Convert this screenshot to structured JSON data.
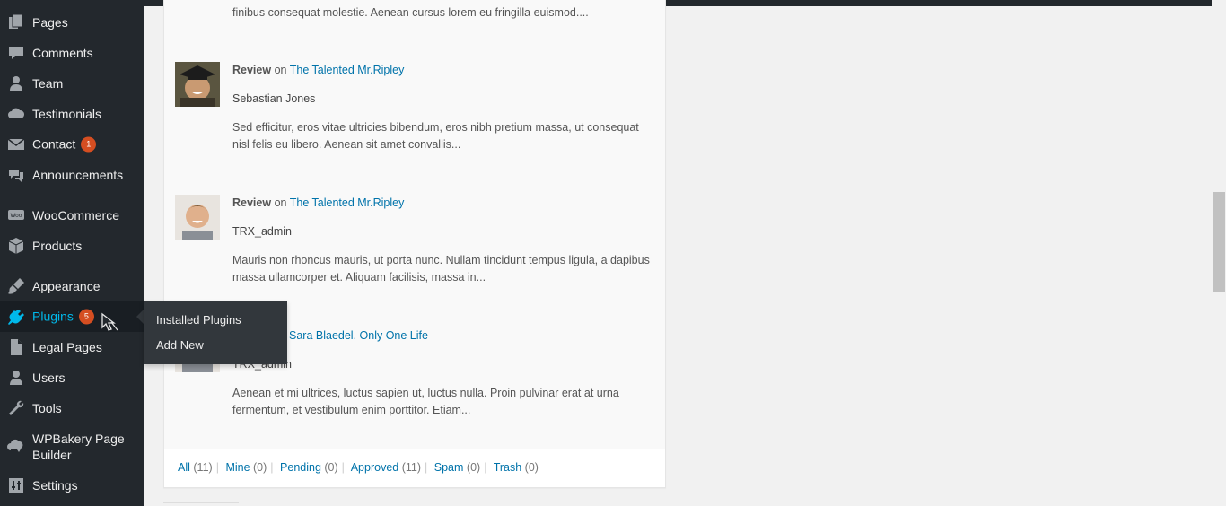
{
  "sidebar": {
    "items": [
      {
        "label": "Pages",
        "icon": "pages-icon"
      },
      {
        "label": "Comments",
        "icon": "comments-icon"
      },
      {
        "label": "Team",
        "icon": "team-icon"
      },
      {
        "label": "Testimonials",
        "icon": "testimonials-icon"
      },
      {
        "label": "Contact",
        "icon": "mail-icon",
        "badge": "1"
      },
      {
        "label": "Announcements",
        "icon": "announcements-icon"
      },
      {
        "label": "WooCommerce",
        "icon": "woocommerce-icon"
      },
      {
        "label": "Products",
        "icon": "products-icon"
      },
      {
        "label": "Appearance",
        "icon": "appearance-icon"
      },
      {
        "label": "Plugins",
        "icon": "plugins-icon",
        "badge": "5",
        "active": true
      },
      {
        "label": "Legal Pages",
        "icon": "legal-pages-icon"
      },
      {
        "label": "Users",
        "icon": "users-icon"
      },
      {
        "label": "Tools",
        "icon": "tools-icon"
      },
      {
        "label": "WPBakery Page Builder",
        "icon": "wpbakery-icon"
      },
      {
        "label": "Settings",
        "icon": "settings-icon"
      }
    ],
    "flyout": {
      "items": [
        "Installed Plugins",
        "Add New"
      ]
    }
  },
  "comments": {
    "top_snippet": "finibus consequat molestie. Aenean cursus lorem eu fringilla euismod....",
    "items": [
      {
        "type": "Review",
        "on": "on",
        "post": "The Talented Mr.Ripley",
        "author": "Sebastian Jones",
        "text": "Sed efficitur, eros vitae ultricies bibendum, eros nibh pretium massa, ut consequat nisl felis eu libero. Aenean sit amet convallis..."
      },
      {
        "type": "Review",
        "on": "on",
        "post": "The Talented Mr.Ripley",
        "author": "TRX_admin",
        "text": "Mauris non rhoncus mauris, ut porta nunc. Nullam tincidunt tempus ligula, a dapibus massa ullamcorper et. Aliquam facilisis, massa in..."
      },
      {
        "post": "Sara Blaedel. Only One Life",
        "author": "TRX_admin",
        "text": "Aenean et mi ultrices, luctus sapien ut, luctus nulla. Proin pulvinar erat at urna fermentum, et vestibulum enim porttitor. Etiam..."
      }
    ]
  },
  "filters": [
    {
      "label": "All",
      "count": "(11)"
    },
    {
      "label": "Mine",
      "count": "(0)"
    },
    {
      "label": "Pending",
      "count": "(0)"
    },
    {
      "label": "Approved",
      "count": "(11)"
    },
    {
      "label": "Spam",
      "count": "(0)"
    },
    {
      "label": "Trash",
      "count": "(0)"
    }
  ],
  "colors": {
    "sidebar_bg": "#23282d",
    "active_bg": "#191e23",
    "accent": "#00b9eb",
    "link": "#0073aa",
    "badge": "#d54e21"
  }
}
